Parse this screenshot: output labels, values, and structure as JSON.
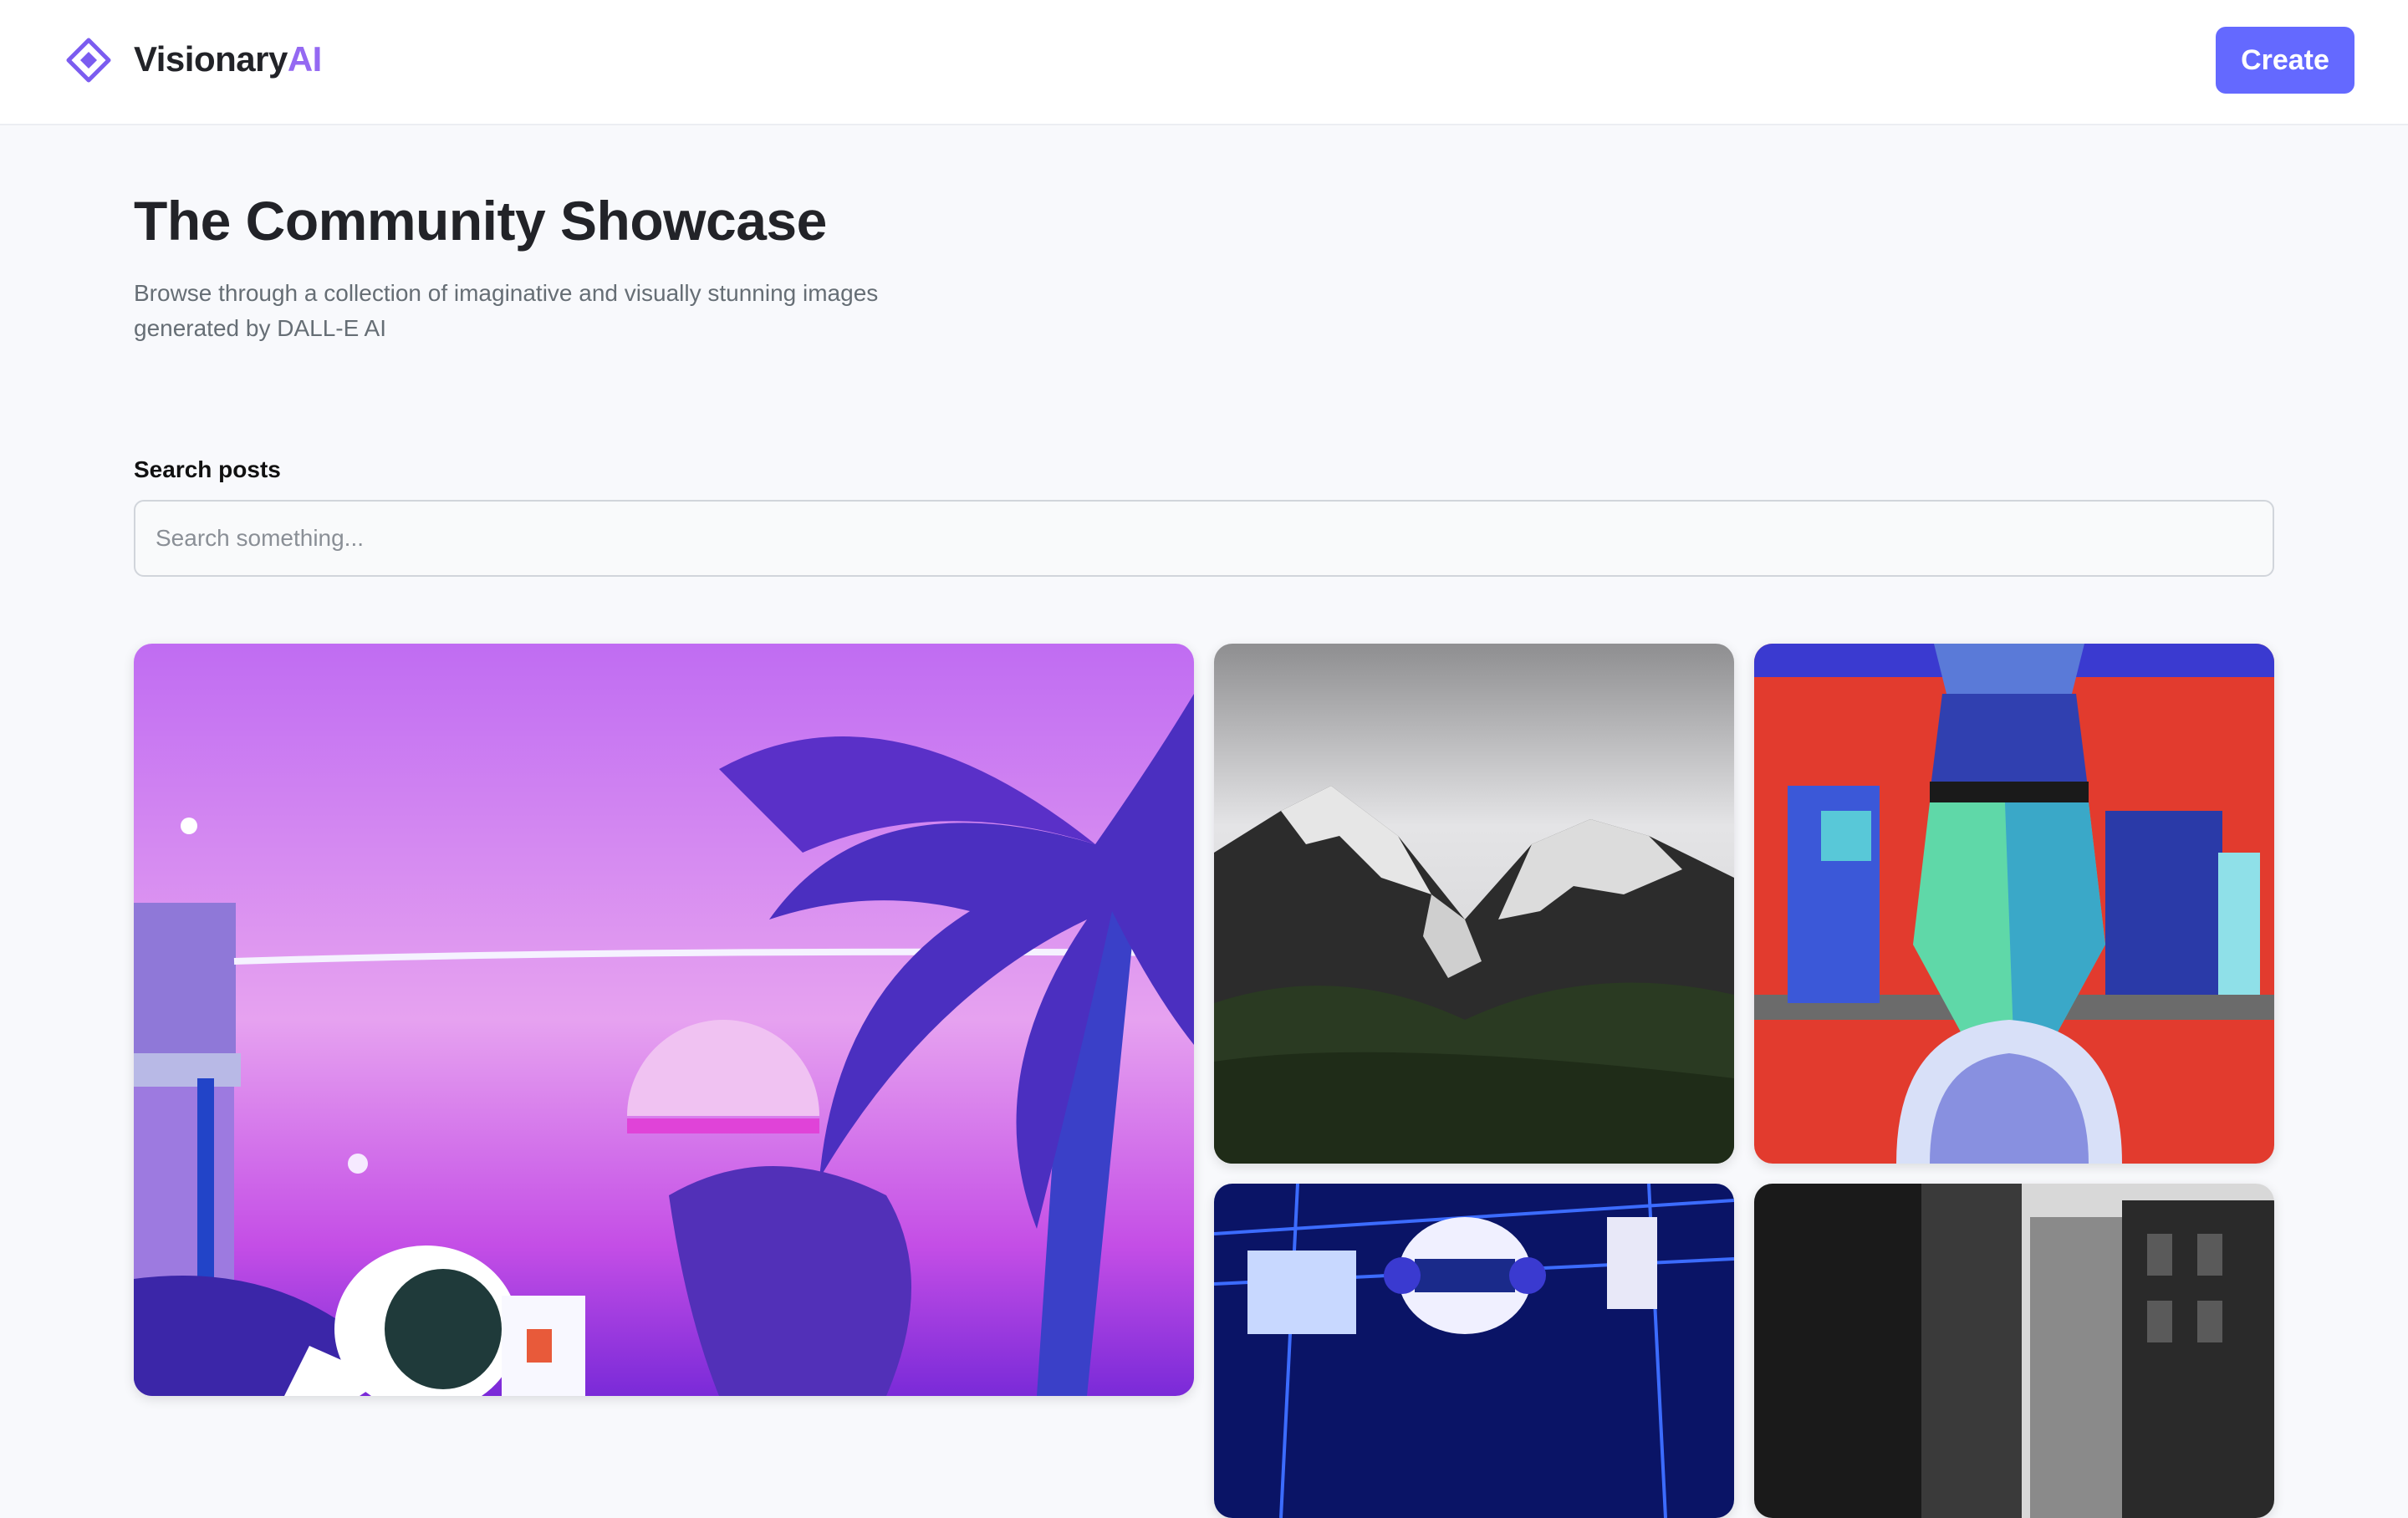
{
  "header": {
    "brand_name": "Visionary",
    "brand_suffix": "AI",
    "create_label": "Create",
    "logo_icon": "diamond-logo-icon"
  },
  "hero": {
    "title": "The Community Showcase",
    "subtitle": "Browse through a collection of imaginative and visually stunning images generated by DALL-E AI"
  },
  "search": {
    "label": "Search posts",
    "placeholder": "Search something...",
    "value": ""
  },
  "gallery": {
    "cards": [
      {
        "subject": "synthwave astronaut under palm trees at sunset"
      },
      {
        "subject": "snow-capped mountains under clouds"
      },
      {
        "subject": "robot bust in a retro laboratory"
      },
      {
        "subject": "neon robot DJ with headphones"
      },
      {
        "subject": "black and white city street"
      }
    ]
  },
  "colors": {
    "accent": "#6469ff",
    "brand_ai": "#9469f2",
    "background": "#f8f9fc",
    "title": "#222328",
    "subtitle": "#666e75"
  }
}
